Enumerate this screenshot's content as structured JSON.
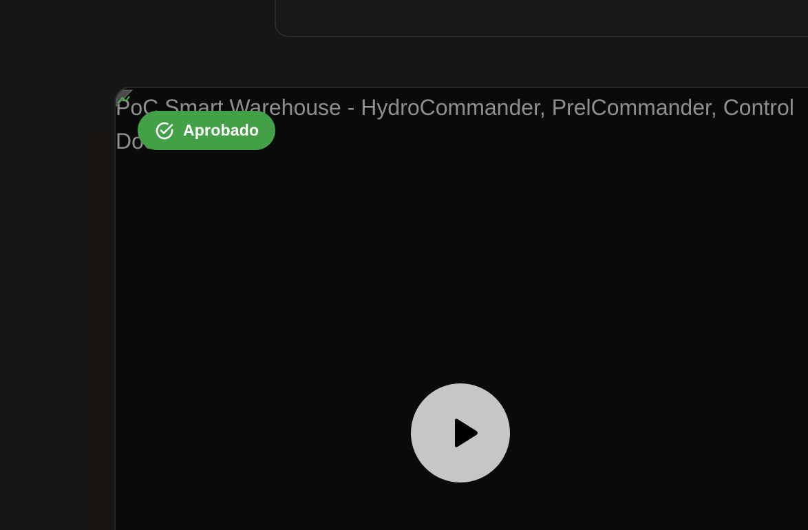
{
  "video": {
    "alt_text": "PoC Smart Warehouse - HydroCommander, PrelCommander, Control Documental",
    "status_badge": {
      "label": "Aprobado",
      "icon": "check-circle-icon",
      "color": "#43a047"
    },
    "play_icon": "play-icon"
  },
  "colors": {
    "background": "#161616",
    "card_background": "#0a0a0a",
    "play_button": "#c6c6c6",
    "alt_text": "#8f8f8f"
  }
}
